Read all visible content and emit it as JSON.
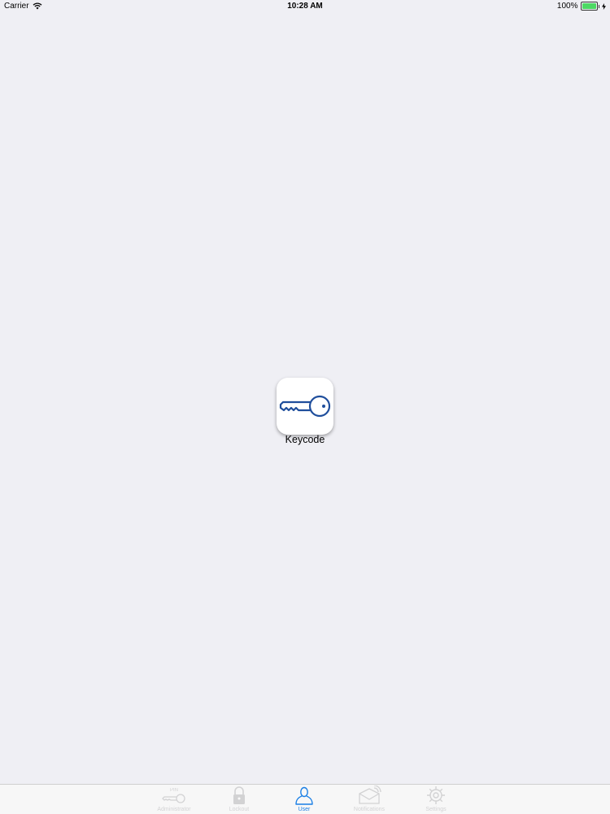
{
  "status_bar": {
    "carrier": "Carrier",
    "time": "10:28 AM",
    "battery": "100%",
    "battery_level": 1.0,
    "wifi_icon": "wifi-icon",
    "charging_icon": "charging-bolt-icon"
  },
  "main": {
    "app_tile": {
      "label": "Keycode",
      "icon": "key-icon"
    }
  },
  "tab_bar": {
    "active_index": 2,
    "items": [
      {
        "label": "Administrator",
        "icon": "pin-key-icon"
      },
      {
        "label": "Lockout",
        "icon": "padlock-icon"
      },
      {
        "label": "User",
        "icon": "user-icon"
      },
      {
        "label": "Notifications",
        "icon": "envelope-signal-icon"
      },
      {
        "label": "Settings",
        "icon": "gear-icon"
      }
    ]
  },
  "colors": {
    "background": "#efeff4",
    "accent": "#1a7fe5",
    "key_blue": "#1f4e9c",
    "inactive": "#8e8e93",
    "battery_green": "#4cd964"
  }
}
